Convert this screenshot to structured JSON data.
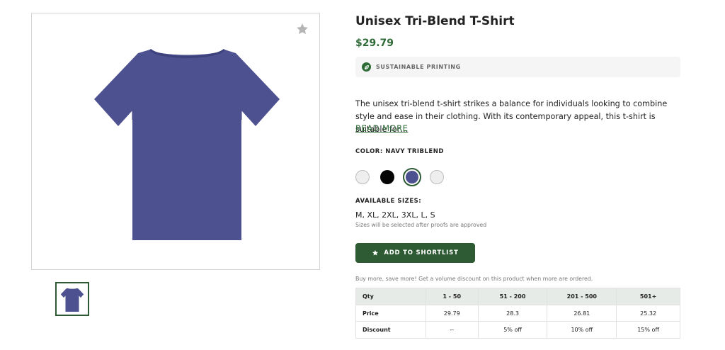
{
  "product": {
    "title": "Unisex Tri-Blend T-Shirt",
    "price": "$29.79",
    "badge": "SUSTAINABLE PRINTING",
    "description": "The unisex tri-blend t-shirt strikes a balance for individuals looking to combine style and ease in their clothing. With its contemporary appeal, this t-shirt is suitable for…",
    "read_more": "READ MORE",
    "color_label": "COLOR: NAVY TRIBLEND",
    "swatch_colors": [
      "#eeeeee",
      "#050505",
      "#4d5190",
      "#eeeeee"
    ],
    "selected_swatch_index": 2,
    "sizes_label": "AVAILABLE SIZES:",
    "sizes": "M, XL, 2XL, 3XL, L, S",
    "sizes_note": "Sizes will be selected after proofs are approved",
    "add_button": "ADD TO SHORTLIST",
    "bulk_note": "Buy more, save more! Get a volume discount on this product when more are ordered."
  },
  "pricing_table": {
    "header": [
      "Qty",
      "1 - 50",
      "51 - 200",
      "201 - 500",
      "501+"
    ],
    "price_row": [
      "Price",
      "29.79",
      "28.3",
      "26.81",
      "25.32"
    ],
    "discount_row": [
      "Discount",
      "--",
      "5% off",
      "10% off",
      "15% off"
    ]
  },
  "icons": {
    "favorite": "star-icon",
    "badge": "leaf-icon",
    "add_button": "star-icon"
  },
  "colors": {
    "accent_green": "#2e5b34",
    "price_green": "#2e6b37",
    "shirt_navy": "#4d5190"
  }
}
